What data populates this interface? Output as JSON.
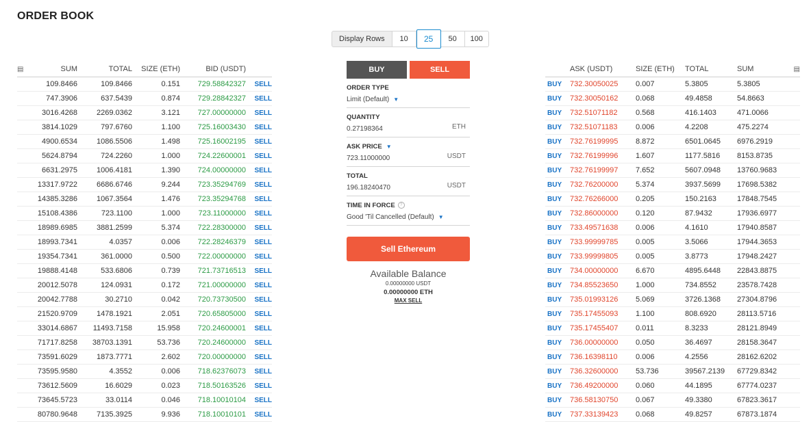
{
  "title": "ORDER BOOK",
  "display_rows": {
    "label": "Display Rows",
    "options": [
      "10",
      "25",
      "50",
      "100"
    ],
    "selected": "25"
  },
  "bids": {
    "headers": {
      "sum": "SUM",
      "total": "TOTAL",
      "size": "SIZE (ETH)",
      "bid": "BID (USDT)"
    },
    "action": "SELL",
    "rows": [
      [
        "109.8466",
        "109.8466",
        "0.151",
        "729.58842327"
      ],
      [
        "747.3906",
        "637.5439",
        "0.874",
        "729.28842327"
      ],
      [
        "3016.4268",
        "2269.0362",
        "3.121",
        "727.00000000"
      ],
      [
        "3814.1029",
        "797.6760",
        "1.100",
        "725.16003430"
      ],
      [
        "4900.6534",
        "1086.5506",
        "1.498",
        "725.16002195"
      ],
      [
        "5624.8794",
        "724.2260",
        "1.000",
        "724.22600001"
      ],
      [
        "6631.2975",
        "1006.4181",
        "1.390",
        "724.00000000"
      ],
      [
        "13317.9722",
        "6686.6746",
        "9.244",
        "723.35294769"
      ],
      [
        "14385.3286",
        "1067.3564",
        "1.476",
        "723.35294768"
      ],
      [
        "15108.4386",
        "723.1100",
        "1.000",
        "723.11000000"
      ],
      [
        "18989.6985",
        "3881.2599",
        "5.374",
        "722.28300000"
      ],
      [
        "18993.7341",
        "4.0357",
        "0.006",
        "722.28246379"
      ],
      [
        "19354.7341",
        "361.0000",
        "0.500",
        "722.00000000"
      ],
      [
        "19888.4148",
        "533.6806",
        "0.739",
        "721.73716513"
      ],
      [
        "20012.5078",
        "124.0931",
        "0.172",
        "721.00000000"
      ],
      [
        "20042.7788",
        "30.2710",
        "0.042",
        "720.73730500"
      ],
      [
        "21520.9709",
        "1478.1921",
        "2.051",
        "720.65805000"
      ],
      [
        "33014.6867",
        "11493.7158",
        "15.958",
        "720.24600001"
      ],
      [
        "71717.8258",
        "38703.1391",
        "53.736",
        "720.24600000"
      ],
      [
        "73591.6029",
        "1873.7771",
        "2.602",
        "720.00000000"
      ],
      [
        "73595.9580",
        "4.3552",
        "0.006",
        "718.62376073"
      ],
      [
        "73612.5609",
        "16.6029",
        "0.023",
        "718.50163526"
      ],
      [
        "73645.5723",
        "33.0114",
        "0.046",
        "718.10010104"
      ],
      [
        "80780.9648",
        "7135.3925",
        "9.936",
        "718.10010101"
      ]
    ]
  },
  "asks": {
    "headers": {
      "ask": "ASK (USDT)",
      "size": "SIZE (ETH)",
      "total": "TOTAL",
      "sum": "SUM"
    },
    "action": "BUY",
    "rows": [
      [
        "732.30050025",
        "0.007",
        "5.3805",
        "5.3805"
      ],
      [
        "732.30050162",
        "0.068",
        "49.4858",
        "54.8663"
      ],
      [
        "732.51071182",
        "0.568",
        "416.1403",
        "471.0066"
      ],
      [
        "732.51071183",
        "0.006",
        "4.2208",
        "475.2274"
      ],
      [
        "732.76199995",
        "8.872",
        "6501.0645",
        "6976.2919"
      ],
      [
        "732.76199996",
        "1.607",
        "1177.5816",
        "8153.8735"
      ],
      [
        "732.76199997",
        "7.652",
        "5607.0948",
        "13760.9683"
      ],
      [
        "732.76200000",
        "5.374",
        "3937.5699",
        "17698.5382"
      ],
      [
        "732.76266000",
        "0.205",
        "150.2163",
        "17848.7545"
      ],
      [
        "732.86000000",
        "0.120",
        "87.9432",
        "17936.6977"
      ],
      [
        "733.49571638",
        "0.006",
        "4.1610",
        "17940.8587"
      ],
      [
        "733.99999785",
        "0.005",
        "3.5066",
        "17944.3653"
      ],
      [
        "733.99999805",
        "0.005",
        "3.8773",
        "17948.2427"
      ],
      [
        "734.00000000",
        "6.670",
        "4895.6448",
        "22843.8875"
      ],
      [
        "734.85523650",
        "1.000",
        "734.8552",
        "23578.7428"
      ],
      [
        "735.01993126",
        "5.069",
        "3726.1368",
        "27304.8796"
      ],
      [
        "735.17455093",
        "1.100",
        "808.6920",
        "28113.5716"
      ],
      [
        "735.17455407",
        "0.011",
        "8.3233",
        "28121.8949"
      ],
      [
        "736.00000000",
        "0.050",
        "36.4697",
        "28158.3647"
      ],
      [
        "736.16398110",
        "0.006",
        "4.2556",
        "28162.6202"
      ],
      [
        "736.32600000",
        "53.736",
        "39567.2139",
        "67729.8342"
      ],
      [
        "736.49200000",
        "0.060",
        "44.1895",
        "67774.0237"
      ],
      [
        "736.58130750",
        "0.067",
        "49.3380",
        "67823.3617"
      ],
      [
        "737.33139423",
        "0.068",
        "49.8257",
        "67873.1874"
      ]
    ]
  },
  "form": {
    "buy_tab": "BUY",
    "sell_tab": "SELL",
    "order_type_label": "ORDER TYPE",
    "order_type_value": "Limit (Default)",
    "quantity_label": "QUANTITY",
    "quantity_value": "0.27198364",
    "quantity_unit": "ETH",
    "ask_price_label": "ASK PRICE",
    "ask_price_value": "723.11000000",
    "ask_price_unit": "USDT",
    "total_label": "TOTAL",
    "total_value": "196.18240470",
    "total_unit": "USDT",
    "tif_label": "TIME IN FORCE",
    "tif_value": "Good 'Til Cancelled (Default)",
    "submit_label": "Sell Ethereum",
    "balance_title": "Available Balance",
    "balance_usdt": "0.00000000  USDT",
    "balance_eth": "0.00000000  ETH",
    "max_sell": "MAX SELL"
  },
  "colors": {
    "bid": "#2c9b45",
    "ask": "#e0452c",
    "link": "#1a73c6",
    "sell_accent": "#f05a3c"
  }
}
